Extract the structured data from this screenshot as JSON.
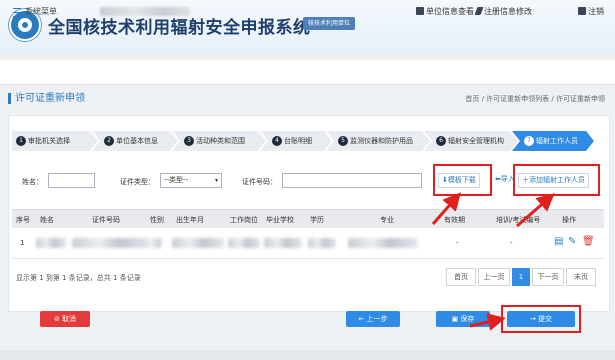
{
  "header": {
    "title": "全国核技术利用辐射安全申报系统",
    "unit_badge": "核技术利用单位"
  },
  "topnav": {
    "menu_label": "系统菜单",
    "unit_info": "单位信息查看",
    "edit_registration": "注册信息修改",
    "logout": "注销"
  },
  "page": {
    "title": "许可证重新申领",
    "breadcrumb": "首页 / 许可证重新申领列表 / 许可证重新申领"
  },
  "steps": [
    {
      "num": "1",
      "label": "审批机关选择"
    },
    {
      "num": "2",
      "label": "单位基本信息"
    },
    {
      "num": "3",
      "label": "活动种类和范围"
    },
    {
      "num": "4",
      "label": "台账明细"
    },
    {
      "num": "5",
      "label": "监测仪器和防护用品"
    },
    {
      "num": "6",
      "label": "辐射安全管理机构"
    },
    {
      "num": "7",
      "label": "辐射工作人员"
    }
  ],
  "filters": {
    "name_label": "姓名：",
    "cert_type_label": "证件类型：",
    "cert_type_value": "--类型--",
    "cert_no_label": "证件号码："
  },
  "toolbar": {
    "query": "查询",
    "template_download": "模板下载",
    "import": "导入",
    "add_worker": "添加辐射工作人员"
  },
  "table": {
    "headers": [
      "序号",
      "姓名",
      "证件号码",
      "性别",
      "出生年月",
      "工作岗位",
      "毕业学校",
      "学历",
      "专业",
      "有效期",
      "培训/考试编号",
      "操作"
    ],
    "rows": [
      {
        "index": "1",
        "validity": "-",
        "training_no": "-"
      }
    ]
  },
  "summary": "显示第 1 到第 1 条记录，总共 1 条记录",
  "pagination": {
    "first": "首页",
    "prev": "上一页",
    "current": "1",
    "next": "下一页",
    "last": "末页"
  },
  "actions": {
    "cancel": "取消",
    "prev_step": "← 上一步",
    "save": "保存",
    "submit": "→ 提交"
  },
  "colors": {
    "primary": "#2f8be6",
    "danger": "#e33b3b",
    "highlight": "#e01f1f"
  }
}
